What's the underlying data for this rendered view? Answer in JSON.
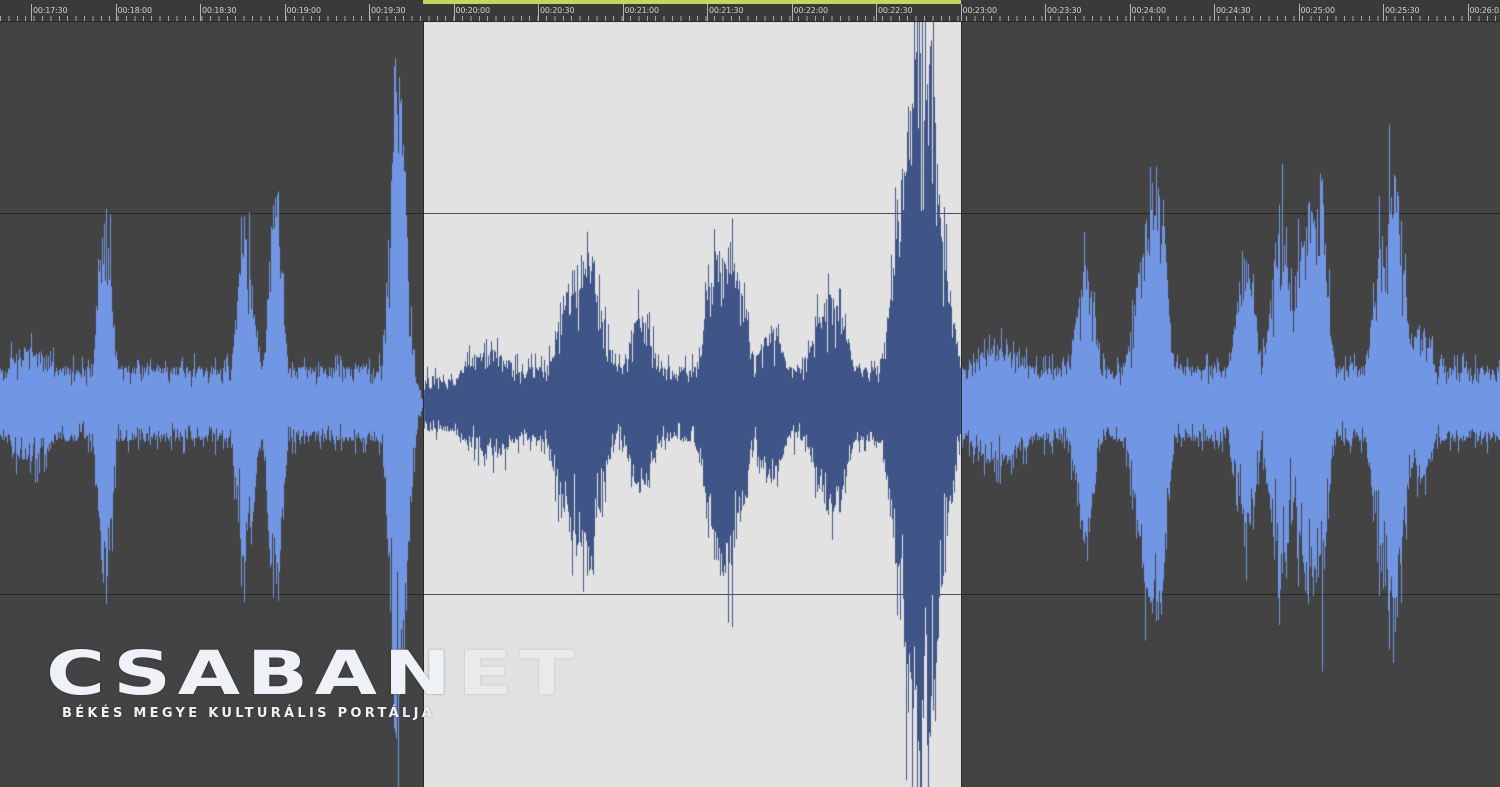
{
  "ruler": {
    "labels": [
      "00:17:30",
      "00:18:00",
      "00:18:30",
      "00:19:00",
      "00:19:30",
      "00:20:00",
      "00:20:30",
      "00:21:00",
      "00:21:30",
      "00:22:00",
      "00:22:30",
      "00:23:00",
      "00:23:30",
      "00:24:00",
      "00:24:30",
      "00:25:00",
      "00:25:30",
      "00:26:0"
    ]
  },
  "selection": {
    "start": "00:19:30",
    "end": "00:23:00"
  },
  "colors": {
    "background": "#434343",
    "selection_background": "#e2e2e2",
    "waveform_unselected": "#7196e4",
    "waveform_selected": "#3f5587",
    "selection_marker": "#c8d45a",
    "grid_line": "#1e1e1e"
  },
  "watermark": {
    "logo_main": "CSABAN",
    "logo_faded": "ET",
    "tagline": "BÉKÉS MEGYE KULTURÁLIS PORTÁLJA"
  }
}
